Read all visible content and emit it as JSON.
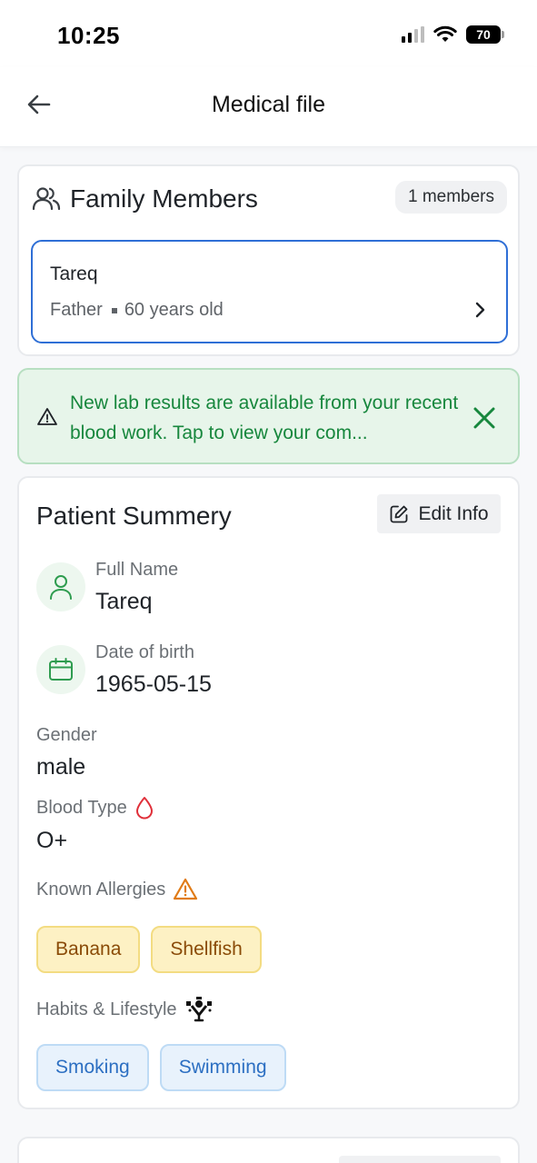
{
  "status_bar": {
    "time": "10:25",
    "battery": "70"
  },
  "header": {
    "title": "Medical file",
    "back_icon": "arrow-left-icon"
  },
  "family": {
    "title": "Family Members",
    "members_count_label": "1 members",
    "members": [
      {
        "name": "Tareq",
        "relation": "Father",
        "age": "60 years old"
      }
    ]
  },
  "alert": {
    "text": "New lab results are available from your recent blood work. Tap to view your com...",
    "color": "#17873d"
  },
  "summary": {
    "title": "Patient Summery",
    "edit_label": "Edit Info",
    "full_name_label": "Full Name",
    "full_name": "Tareq",
    "dob_label": "Date of birth",
    "dob": "1965-05-15",
    "gender_label": "Gender",
    "gender": "male",
    "blood_type_label": "Blood Type",
    "blood_type": "O+",
    "allergies_label": "Known Allergies",
    "allergies": [
      "Banana",
      "Shellfish"
    ],
    "habits_label": "Habits & Lifestyle",
    "habits": [
      "Smoking",
      "Swimming"
    ]
  }
}
